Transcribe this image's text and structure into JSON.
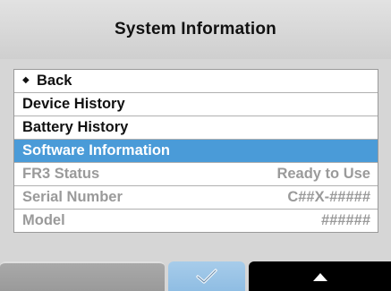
{
  "title": "System Information",
  "menu": {
    "back_label": "Back",
    "device_history": "Device History",
    "battery_history": "Battery History",
    "software_information": "Software Information",
    "fr3_status_label": "FR3 Status",
    "fr3_status_value": "Ready to Use",
    "serial_number_label": "Serial Number",
    "serial_number_value": "C##X-#####",
    "model_label": "Model",
    "model_value": "######"
  },
  "softkeys": {
    "left_icon": "blank",
    "middle_icon": "check-icon",
    "right_icon": "up-arrow-icon"
  },
  "colors": {
    "selection": "#4a9bd8",
    "disabled_text": "#9a9a9a"
  }
}
